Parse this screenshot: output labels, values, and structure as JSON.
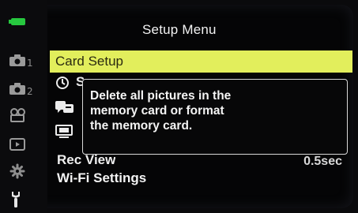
{
  "header": {
    "title": "Setup Menu",
    "battery_color": "#27c83f"
  },
  "sidebar": {
    "items": [
      {
        "icon": "camera-icon",
        "sub": "1"
      },
      {
        "icon": "camera-icon",
        "sub": "2"
      },
      {
        "icon": "movie-camera-icon",
        "sub": ""
      },
      {
        "icon": "playback-icon",
        "sub": ""
      },
      {
        "icon": "gear-icon",
        "sub": ""
      },
      {
        "icon": "wrench-icon",
        "sub": ""
      }
    ]
  },
  "menu": {
    "selected_label": "Card Setup",
    "selected_color": "#e2ee5c",
    "row2_icon": "clock-icon",
    "row2_glimpse": "S",
    "row3_icon": "language-icon",
    "row4_icon": "monitor-icon",
    "rec_view_label": "Rec View",
    "rec_view_value": "0.5sec",
    "wifi_label": "Wi-Fi Settings"
  },
  "tooltip": {
    "lines": [
      "Delete all pictures in the",
      "memory card or format",
      "the memory card."
    ]
  }
}
